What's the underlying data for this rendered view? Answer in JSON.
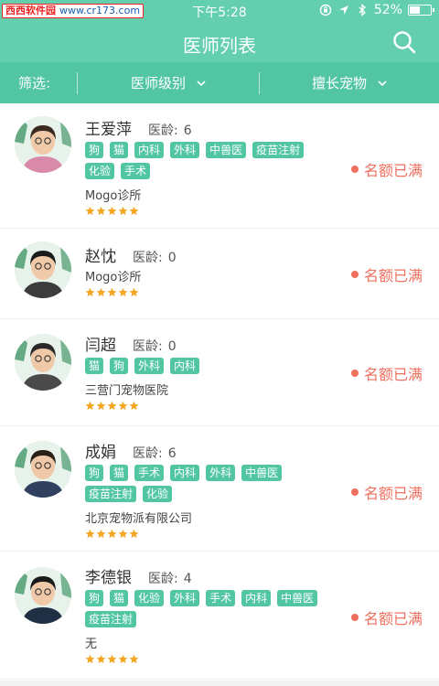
{
  "status_bar": {
    "watermark_name": "西西软件园",
    "watermark_url": "www.cr173.com",
    "time": "下午5:28",
    "battery": "52%",
    "battery_level": 0.52
  },
  "header": {
    "title": "医师列表",
    "search_icon": "search-icon"
  },
  "filter": {
    "label": "筛选:",
    "level_label": "医师级别",
    "pet_label": "擅长宠物"
  },
  "colors": {
    "brand": "#63cfae",
    "tag": "#52c6a3",
    "status": "#f07060",
    "star": "#f5a623"
  },
  "doctors": [
    {
      "name": "王爱萍",
      "age_label": "医龄:",
      "age": "6",
      "tags": [
        "狗",
        "猫",
        "内科",
        "外科",
        "中兽医",
        "疫苗注射",
        "化验",
        "手术"
      ],
      "clinic": "Mogo诊所",
      "rating": 5,
      "status": "名额已满"
    },
    {
      "name": "赵忱",
      "age_label": "医龄:",
      "age": "0",
      "tags": [],
      "clinic": "Mogo诊所",
      "rating": 5,
      "status": "名额已满"
    },
    {
      "name": "闫超",
      "age_label": "医龄:",
      "age": "0",
      "tags": [
        "猫",
        "狗",
        "外科",
        "内科"
      ],
      "clinic": "三营门宠物医院",
      "rating": 5,
      "status": "名额已满"
    },
    {
      "name": "成娟",
      "age_label": "医龄:",
      "age": "6",
      "tags": [
        "狗",
        "猫",
        "手术",
        "内科",
        "外科",
        "中兽医",
        "疫苗注射",
        "化验"
      ],
      "clinic": "北京宠物派有限公司",
      "rating": 5,
      "status": "名额已满"
    },
    {
      "name": "李德银",
      "age_label": "医龄:",
      "age": "4",
      "tags": [
        "狗",
        "猫",
        "化验",
        "外科",
        "手术",
        "内科",
        "中兽医",
        "疫苗注射"
      ],
      "clinic": "无",
      "rating": 5,
      "status": "名额已满"
    }
  ]
}
